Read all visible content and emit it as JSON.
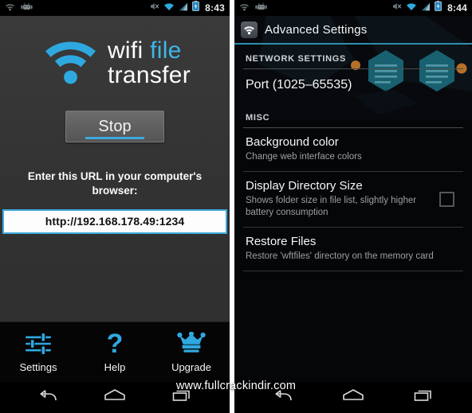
{
  "left_phone": {
    "status_bar": {
      "time": "8:43",
      "icons": [
        "wifi-icon",
        "android-robot-icon",
        "mute-icon",
        "wifi-signal-icon",
        "cell-signal-icon",
        "battery-icon"
      ]
    },
    "logo": {
      "word1": "wifi",
      "word2": "file",
      "word3": "transfer",
      "icon": "wifi-arc-icon",
      "accent_color": "#3fb6e8"
    },
    "stop_button": {
      "label": "Stop",
      "accent_color": "#3fa9dd"
    },
    "url_prompt": "Enter this URL in your computer's browser:",
    "url_value": "http://192.168.178.49:1234",
    "tabs": [
      {
        "label": "Settings",
        "icon": "sliders-icon"
      },
      {
        "label": "Help",
        "icon": "question-mark-icon"
      },
      {
        "label": "Upgrade",
        "icon": "crown-icon"
      }
    ],
    "nav_bar": [
      "back-icon",
      "home-icon",
      "recents-icon"
    ]
  },
  "right_phone": {
    "status_bar": {
      "time": "8:44",
      "icons": [
        "wifi-icon",
        "android-robot-icon",
        "mute-icon",
        "wifi-signal-icon",
        "cell-signal-icon",
        "battery-icon"
      ]
    },
    "action_bar": {
      "title": "Advanced Settings",
      "icon": "app-wifi-icon",
      "rule_color": "#2e8fae"
    },
    "sections": [
      {
        "header": "NETWORK SETTINGS",
        "rows": [
          {
            "title": "Port (1025–65535)",
            "subtitle": "",
            "control": "none"
          }
        ]
      },
      {
        "header": "MISC",
        "rows": [
          {
            "title": "Background color",
            "subtitle": "Change web interface colors",
            "control": "none"
          },
          {
            "title": "Display Directory Size",
            "subtitle": "Shows folder size in file list, slightly higher battery consumption",
            "control": "checkbox",
            "checked": false
          },
          {
            "title": "Restore Files",
            "subtitle": "Restore 'wftfiles' directory on the memory card",
            "control": "none"
          }
        ]
      }
    ],
    "nav_bar": [
      "back-icon",
      "home-icon",
      "recents-icon"
    ]
  },
  "watermark": "www.fullcrackindir.com"
}
